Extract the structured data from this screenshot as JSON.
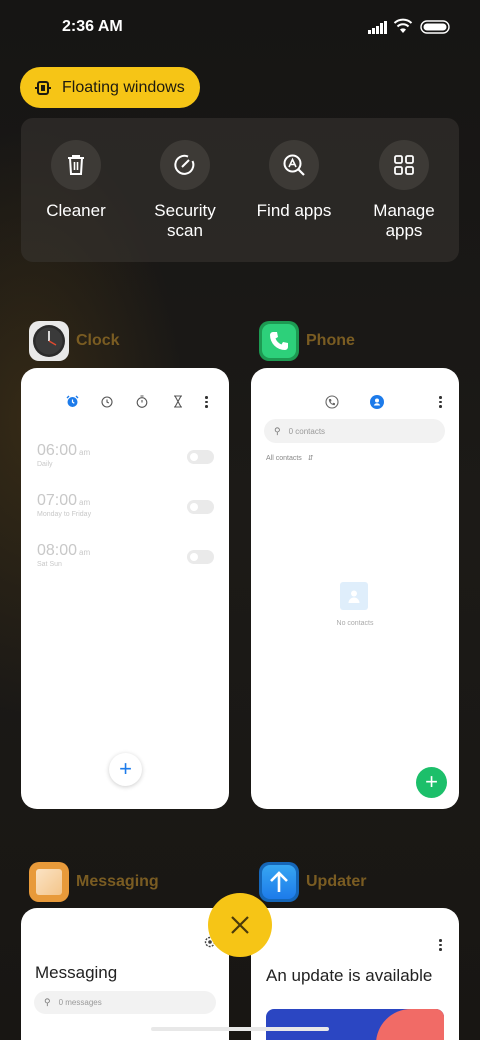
{
  "status_bar": {
    "time": "2:36 AM"
  },
  "floating_windows": {
    "label": "Floating windows"
  },
  "quick_actions": [
    {
      "label": "Cleaner",
      "icon": "trash-icon"
    },
    {
      "label": "Security\nscan",
      "icon": "security-scan-icon"
    },
    {
      "label": "Find apps",
      "icon": "find-apps-icon"
    },
    {
      "label": "Manage\napps",
      "icon": "grid-icon"
    }
  ],
  "apps": {
    "clock": {
      "name": "Clock",
      "alarms": [
        {
          "time": "06:00",
          "ampm": "am",
          "repeat": "Daily"
        },
        {
          "time": "07:00",
          "ampm": "am",
          "repeat": "Monday to Friday"
        },
        {
          "time": "08:00",
          "ampm": "am",
          "repeat": "Sat Sun"
        }
      ]
    },
    "phone": {
      "name": "Phone",
      "search_placeholder": "0 contacts",
      "filter": "All contacts",
      "empty_text": "No contacts"
    },
    "messaging": {
      "name": "Messaging",
      "title": "Messaging",
      "search_placeholder": "0 messages"
    },
    "updater": {
      "name": "Updater",
      "title": "An update is available"
    }
  },
  "colors": {
    "accent_yellow": "#f6c516",
    "app_label": "#7a5c22",
    "phone_green": "#1cbf6a",
    "clock_blue": "#1d7bea"
  }
}
